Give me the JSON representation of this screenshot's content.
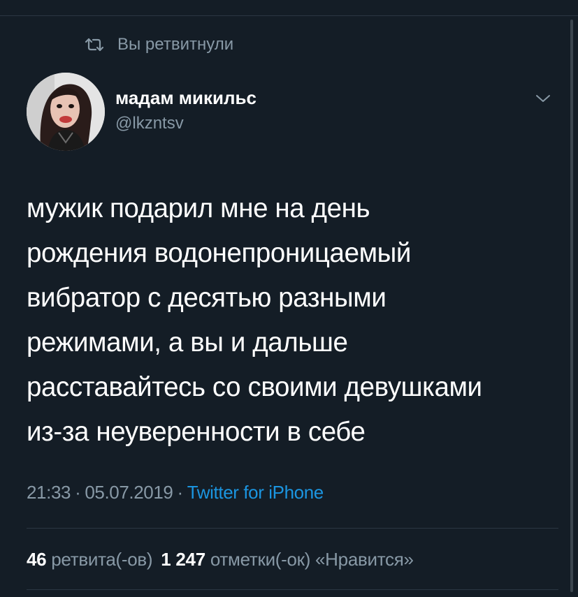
{
  "colors": {
    "background": "#141d26",
    "primary_text": "#ffffff",
    "secondary_text": "#8899a6",
    "link": "#1b95e0",
    "divider": "#2b3743"
  },
  "retweet_context": {
    "icon": "retweet-icon",
    "label": "Вы ретвитнули"
  },
  "author": {
    "avatar_icon": "avatar-photo",
    "display_name": "мадам микильс",
    "handle": "@lkzntsv",
    "menu_icon": "chevron-down-icon"
  },
  "tweet": {
    "lines": [
      "мужик подарил мне на день",
      "рождения водонепроницаемый",
      "вибратор с десятью разными",
      "режимами, а вы и дальше",
      "расставайтесь со своими девушками",
      "из-за неуверенности в себе"
    ]
  },
  "meta": {
    "time": "21:33",
    "separator": "·",
    "date": "05.07.2019",
    "source": "Twitter for iPhone"
  },
  "stats": {
    "retweets_count": "46",
    "retweets_label": "ретвита(-ов)",
    "likes_count": "1 247",
    "likes_label": "отметки(-ок) «Нравится»"
  }
}
